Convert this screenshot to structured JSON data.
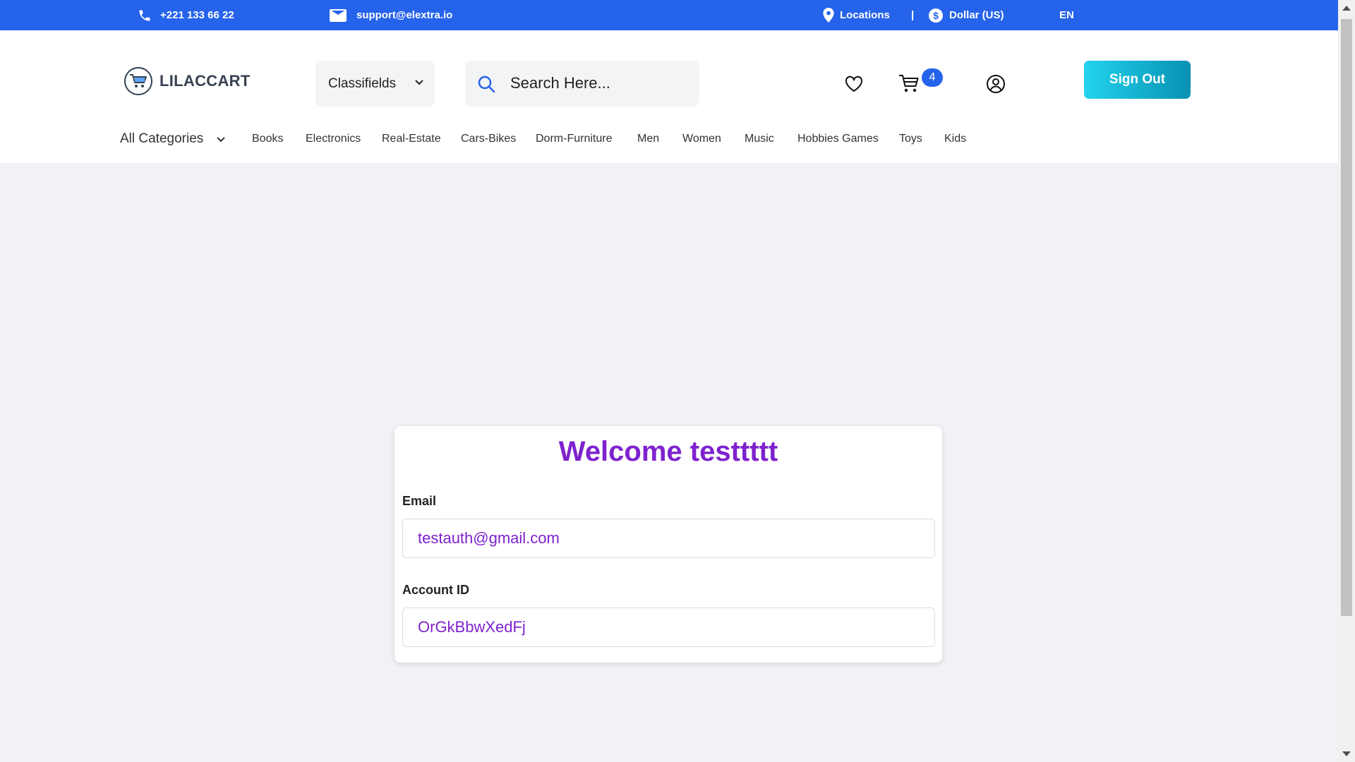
{
  "topbar": {
    "phone": "+221 133 66 22",
    "email": "support@elextra.io",
    "locations": "Locations",
    "separator": "|",
    "currency": "Dollar (US)",
    "language": "EN",
    "bg_color": "#2563eb"
  },
  "header": {
    "brand": "LILACCART",
    "select_value": "Classifields",
    "search_placeholder": "Search Here...",
    "cart_count": "4",
    "signout_label": "Sign Out"
  },
  "categories": {
    "all_label": "All Categories",
    "items": [
      "Books",
      "Electronics",
      "Real-Estate",
      "Cars-Bikes",
      "Dorm-Furniture",
      "Men",
      "Women",
      "Music",
      "Hobbies Games",
      "Toys",
      "Kids"
    ]
  },
  "profile": {
    "welcome": "Welcome testtttt",
    "email_label": "Email",
    "email_value": "testauth@gmail.com",
    "account_label": "Account ID",
    "account_value": "OrGkBbwXedFj",
    "accent_color": "#7e22ce"
  },
  "icons": [
    "phone-icon",
    "mail-icon",
    "location-icon",
    "dollar-icon",
    "cart-logo-icon",
    "chevron-down-icon",
    "search-icon",
    "heart-icon",
    "cart-icon",
    "user-icon"
  ]
}
